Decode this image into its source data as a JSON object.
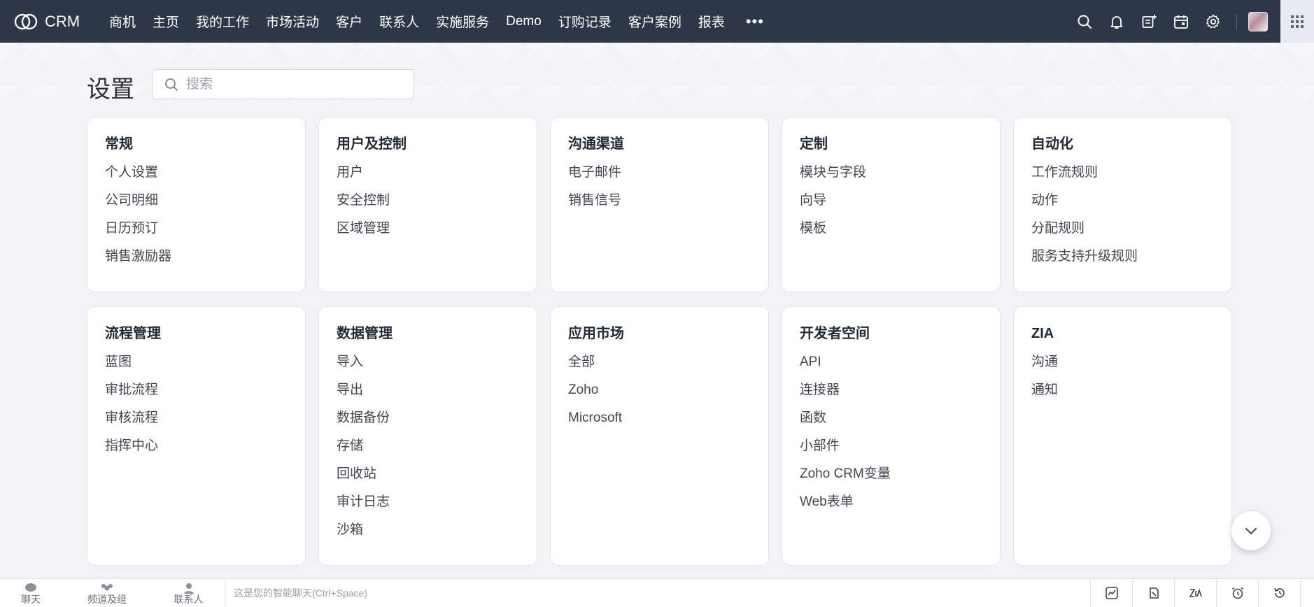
{
  "app": {
    "brand_name": "CRM"
  },
  "nav": {
    "tabs": [
      "商机",
      "主页",
      "我的工作",
      "市场活动",
      "客户",
      "联系人",
      "实施服务",
      "Demo",
      "订购记录",
      "客户案例",
      "报表"
    ],
    "more_label": "•••",
    "icons": [
      "search-icon",
      "bell-icon",
      "add-note-icon",
      "calendar-icon",
      "gear-icon",
      "avatar",
      "apps-grid-icon"
    ]
  },
  "page": {
    "title": "设置",
    "search_placeholder": "搜索"
  },
  "cards": [
    {
      "title": "常规",
      "links": [
        "个人设置",
        "公司明细",
        "日历预订",
        "销售激励器"
      ]
    },
    {
      "title": "用户及控制",
      "links": [
        "用户",
        "安全控制",
        "区域管理"
      ]
    },
    {
      "title": "沟通渠道",
      "links": [
        "电子邮件",
        "销售信号"
      ]
    },
    {
      "title": "定制",
      "links": [
        "模块与字段",
        "向导",
        "模板"
      ]
    },
    {
      "title": "自动化",
      "links": [
        "工作流规则",
        "动作",
        "分配规则",
        "服务支持升级规则"
      ]
    },
    {
      "title": "流程管理",
      "links": [
        "蓝图",
        "审批流程",
        "审核流程",
        "指挥中心"
      ]
    },
    {
      "title": "数据管理",
      "links": [
        "导入",
        "导出",
        "数据备份",
        "存储",
        "回收站",
        "审计日志",
        "沙箱"
      ]
    },
    {
      "title": "应用市场",
      "links": [
        "全部",
        "Zoho",
        "Microsoft"
      ]
    },
    {
      "title": "开发者空间",
      "links": [
        "API",
        "连接器",
        "函数",
        "小部件",
        "Zoho CRM变量",
        "Web表单"
      ]
    },
    {
      "title": "ZIA",
      "links": [
        "沟通",
        "通知"
      ]
    }
  ],
  "bottombar": {
    "items": [
      "聊天",
      "频道及组",
      "联系人"
    ],
    "chat_placeholder": "这是您的智能聊天(Ctrl+Space)",
    "tools": [
      "activity-icon",
      "notes-icon",
      "zia-icon",
      "alarm-icon",
      "history-icon"
    ]
  },
  "colors": {
    "nav_bg": "#2d3748",
    "page_bg": "#f1f3f7",
    "card_bg": "#ffffff"
  }
}
